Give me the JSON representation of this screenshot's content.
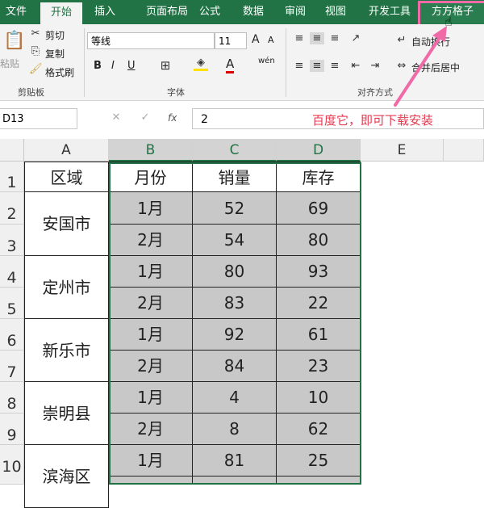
{
  "ribbon_tabs": [
    "文件",
    "开始",
    "插入",
    "页面布局",
    "公式",
    "数据",
    "审阅",
    "视图",
    "开发工具",
    "方方格子"
  ],
  "clipboard": {
    "paste": "粘贴",
    "cut": "剪切",
    "copy": "复制",
    "format_painter": "格式刷",
    "group": "剪贴板"
  },
  "font": {
    "name": "等线",
    "size": "11",
    "grow": "A",
    "shrink": "A",
    "bold": "B",
    "italic": "I",
    "underline": "U",
    "color_a": "A",
    "pinyin": "wén",
    "group": "字体"
  },
  "alignment": {
    "wrap": "自动换行",
    "merge": "合并后居中",
    "group": "对齐方式"
  },
  "formula_bar": {
    "name_box": "D13",
    "fx": "fx",
    "value": "2"
  },
  "annotation": "百度它，即可下载安装",
  "colors": {
    "accent": "#217346",
    "highlight": "#f06aa8",
    "annotation": "#e8384f",
    "selection": "#c8c8c8"
  },
  "columns": [
    "A",
    "B",
    "C",
    "D",
    "E"
  ],
  "rows": [
    "1",
    "2",
    "3",
    "4",
    "5",
    "6",
    "7",
    "8",
    "9",
    "10"
  ],
  "table": {
    "headers": [
      "区域",
      "月份",
      "销量",
      "库存"
    ],
    "regions": [
      "安国市",
      "定州市",
      "新乐市",
      "崇明县",
      "滨海区"
    ],
    "data": [
      [
        "1月",
        "52",
        "69"
      ],
      [
        "2月",
        "54",
        "80"
      ],
      [
        "1月",
        "80",
        "93"
      ],
      [
        "2月",
        "83",
        "22"
      ],
      [
        "1月",
        "92",
        "61"
      ],
      [
        "2月",
        "84",
        "23"
      ],
      [
        "1月",
        "4",
        "10"
      ],
      [
        "2月",
        "8",
        "62"
      ],
      [
        "1月",
        "81",
        "25"
      ]
    ]
  }
}
